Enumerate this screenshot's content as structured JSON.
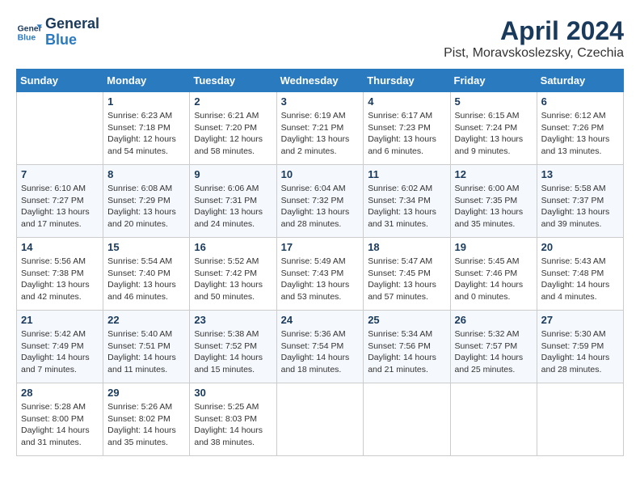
{
  "header": {
    "logo_line1": "General",
    "logo_line2": "Blue",
    "month": "April 2024",
    "location": "Pist, Moravskoslezsky, Czechia"
  },
  "weekdays": [
    "Sunday",
    "Monday",
    "Tuesday",
    "Wednesday",
    "Thursday",
    "Friday",
    "Saturday"
  ],
  "weeks": [
    [
      {
        "day": "",
        "empty": true
      },
      {
        "day": "1",
        "sunrise": "6:23 AM",
        "sunset": "7:18 PM",
        "daylight": "12 hours and 54 minutes."
      },
      {
        "day": "2",
        "sunrise": "6:21 AM",
        "sunset": "7:20 PM",
        "daylight": "12 hours and 58 minutes."
      },
      {
        "day": "3",
        "sunrise": "6:19 AM",
        "sunset": "7:21 PM",
        "daylight": "13 hours and 2 minutes."
      },
      {
        "day": "4",
        "sunrise": "6:17 AM",
        "sunset": "7:23 PM",
        "daylight": "13 hours and 6 minutes."
      },
      {
        "day": "5",
        "sunrise": "6:15 AM",
        "sunset": "7:24 PM",
        "daylight": "13 hours and 9 minutes."
      },
      {
        "day": "6",
        "sunrise": "6:12 AM",
        "sunset": "7:26 PM",
        "daylight": "13 hours and 13 minutes."
      }
    ],
    [
      {
        "day": "7",
        "sunrise": "6:10 AM",
        "sunset": "7:27 PM",
        "daylight": "13 hours and 17 minutes."
      },
      {
        "day": "8",
        "sunrise": "6:08 AM",
        "sunset": "7:29 PM",
        "daylight": "13 hours and 20 minutes."
      },
      {
        "day": "9",
        "sunrise": "6:06 AM",
        "sunset": "7:31 PM",
        "daylight": "13 hours and 24 minutes."
      },
      {
        "day": "10",
        "sunrise": "6:04 AM",
        "sunset": "7:32 PM",
        "daylight": "13 hours and 28 minutes."
      },
      {
        "day": "11",
        "sunrise": "6:02 AM",
        "sunset": "7:34 PM",
        "daylight": "13 hours and 31 minutes."
      },
      {
        "day": "12",
        "sunrise": "6:00 AM",
        "sunset": "7:35 PM",
        "daylight": "13 hours and 35 minutes."
      },
      {
        "day": "13",
        "sunrise": "5:58 AM",
        "sunset": "7:37 PM",
        "daylight": "13 hours and 39 minutes."
      }
    ],
    [
      {
        "day": "14",
        "sunrise": "5:56 AM",
        "sunset": "7:38 PM",
        "daylight": "13 hours and 42 minutes."
      },
      {
        "day": "15",
        "sunrise": "5:54 AM",
        "sunset": "7:40 PM",
        "daylight": "13 hours and 46 minutes."
      },
      {
        "day": "16",
        "sunrise": "5:52 AM",
        "sunset": "7:42 PM",
        "daylight": "13 hours and 50 minutes."
      },
      {
        "day": "17",
        "sunrise": "5:49 AM",
        "sunset": "7:43 PM",
        "daylight": "13 hours and 53 minutes."
      },
      {
        "day": "18",
        "sunrise": "5:47 AM",
        "sunset": "7:45 PM",
        "daylight": "13 hours and 57 minutes."
      },
      {
        "day": "19",
        "sunrise": "5:45 AM",
        "sunset": "7:46 PM",
        "daylight": "14 hours and 0 minutes."
      },
      {
        "day": "20",
        "sunrise": "5:43 AM",
        "sunset": "7:48 PM",
        "daylight": "14 hours and 4 minutes."
      }
    ],
    [
      {
        "day": "21",
        "sunrise": "5:42 AM",
        "sunset": "7:49 PM",
        "daylight": "14 hours and 7 minutes."
      },
      {
        "day": "22",
        "sunrise": "5:40 AM",
        "sunset": "7:51 PM",
        "daylight": "14 hours and 11 minutes."
      },
      {
        "day": "23",
        "sunrise": "5:38 AM",
        "sunset": "7:52 PM",
        "daylight": "14 hours and 15 minutes."
      },
      {
        "day": "24",
        "sunrise": "5:36 AM",
        "sunset": "7:54 PM",
        "daylight": "14 hours and 18 minutes."
      },
      {
        "day": "25",
        "sunrise": "5:34 AM",
        "sunset": "7:56 PM",
        "daylight": "14 hours and 21 minutes."
      },
      {
        "day": "26",
        "sunrise": "5:32 AM",
        "sunset": "7:57 PM",
        "daylight": "14 hours and 25 minutes."
      },
      {
        "day": "27",
        "sunrise": "5:30 AM",
        "sunset": "7:59 PM",
        "daylight": "14 hours and 28 minutes."
      }
    ],
    [
      {
        "day": "28",
        "sunrise": "5:28 AM",
        "sunset": "8:00 PM",
        "daylight": "14 hours and 31 minutes."
      },
      {
        "day": "29",
        "sunrise": "5:26 AM",
        "sunset": "8:02 PM",
        "daylight": "14 hours and 35 minutes."
      },
      {
        "day": "30",
        "sunrise": "5:25 AM",
        "sunset": "8:03 PM",
        "daylight": "14 hours and 38 minutes."
      },
      {
        "day": "",
        "empty": true
      },
      {
        "day": "",
        "empty": true
      },
      {
        "day": "",
        "empty": true
      },
      {
        "day": "",
        "empty": true
      }
    ]
  ]
}
